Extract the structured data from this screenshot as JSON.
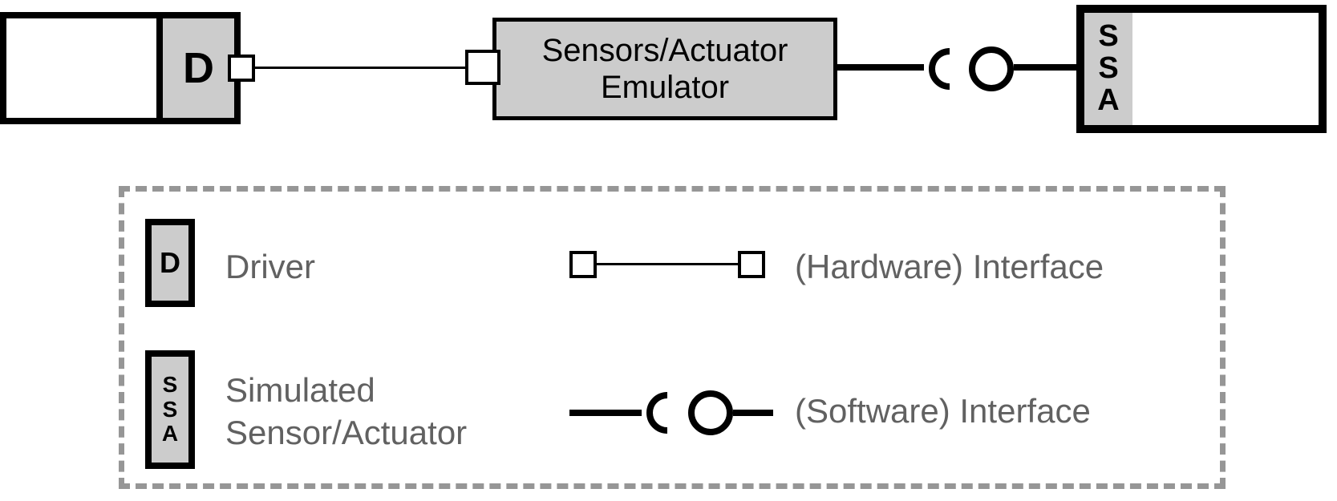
{
  "diagram": {
    "driver_label": "D",
    "emulator_label": "Sensors/Actuator\nEmulator",
    "ssa_label_s1": "S",
    "ssa_label_s2": "S",
    "ssa_label_a": "A"
  },
  "legend": {
    "driver_symbol": "D",
    "driver_text": "Driver",
    "ssa_s1": "S",
    "ssa_s2": "S",
    "ssa_a": "A",
    "ssa_text": "Simulated\nSensor/Actuator",
    "hw_text": "(Hardware) Interface",
    "sw_text": "(Software) Interface"
  }
}
